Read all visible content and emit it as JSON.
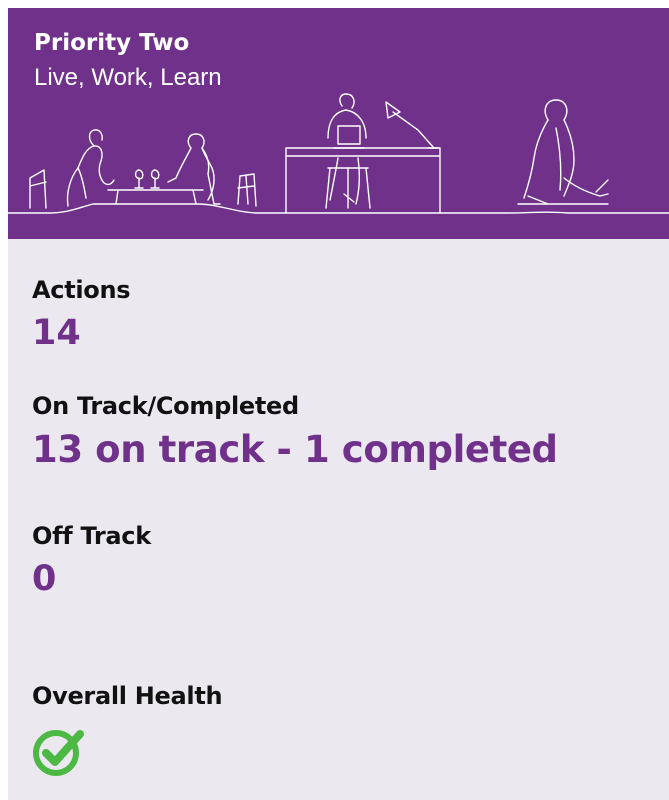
{
  "banner": {
    "title": "Priority Two",
    "subtitle": "Live, Work, Learn",
    "background_color": "#70318b"
  },
  "stats": {
    "actions": {
      "label": "Actions",
      "value": "14"
    },
    "on_track": {
      "label": "On Track/Completed",
      "value": "13 on track - 1 completed"
    },
    "off_track": {
      "label": "Off Track",
      "value": "0"
    },
    "health": {
      "label": "Overall Health",
      "icon": "green-checkmark-circle-icon"
    }
  },
  "colors": {
    "accent": "#70318b",
    "health_green": "#4cb944",
    "card_background": "#ebe9ef"
  }
}
